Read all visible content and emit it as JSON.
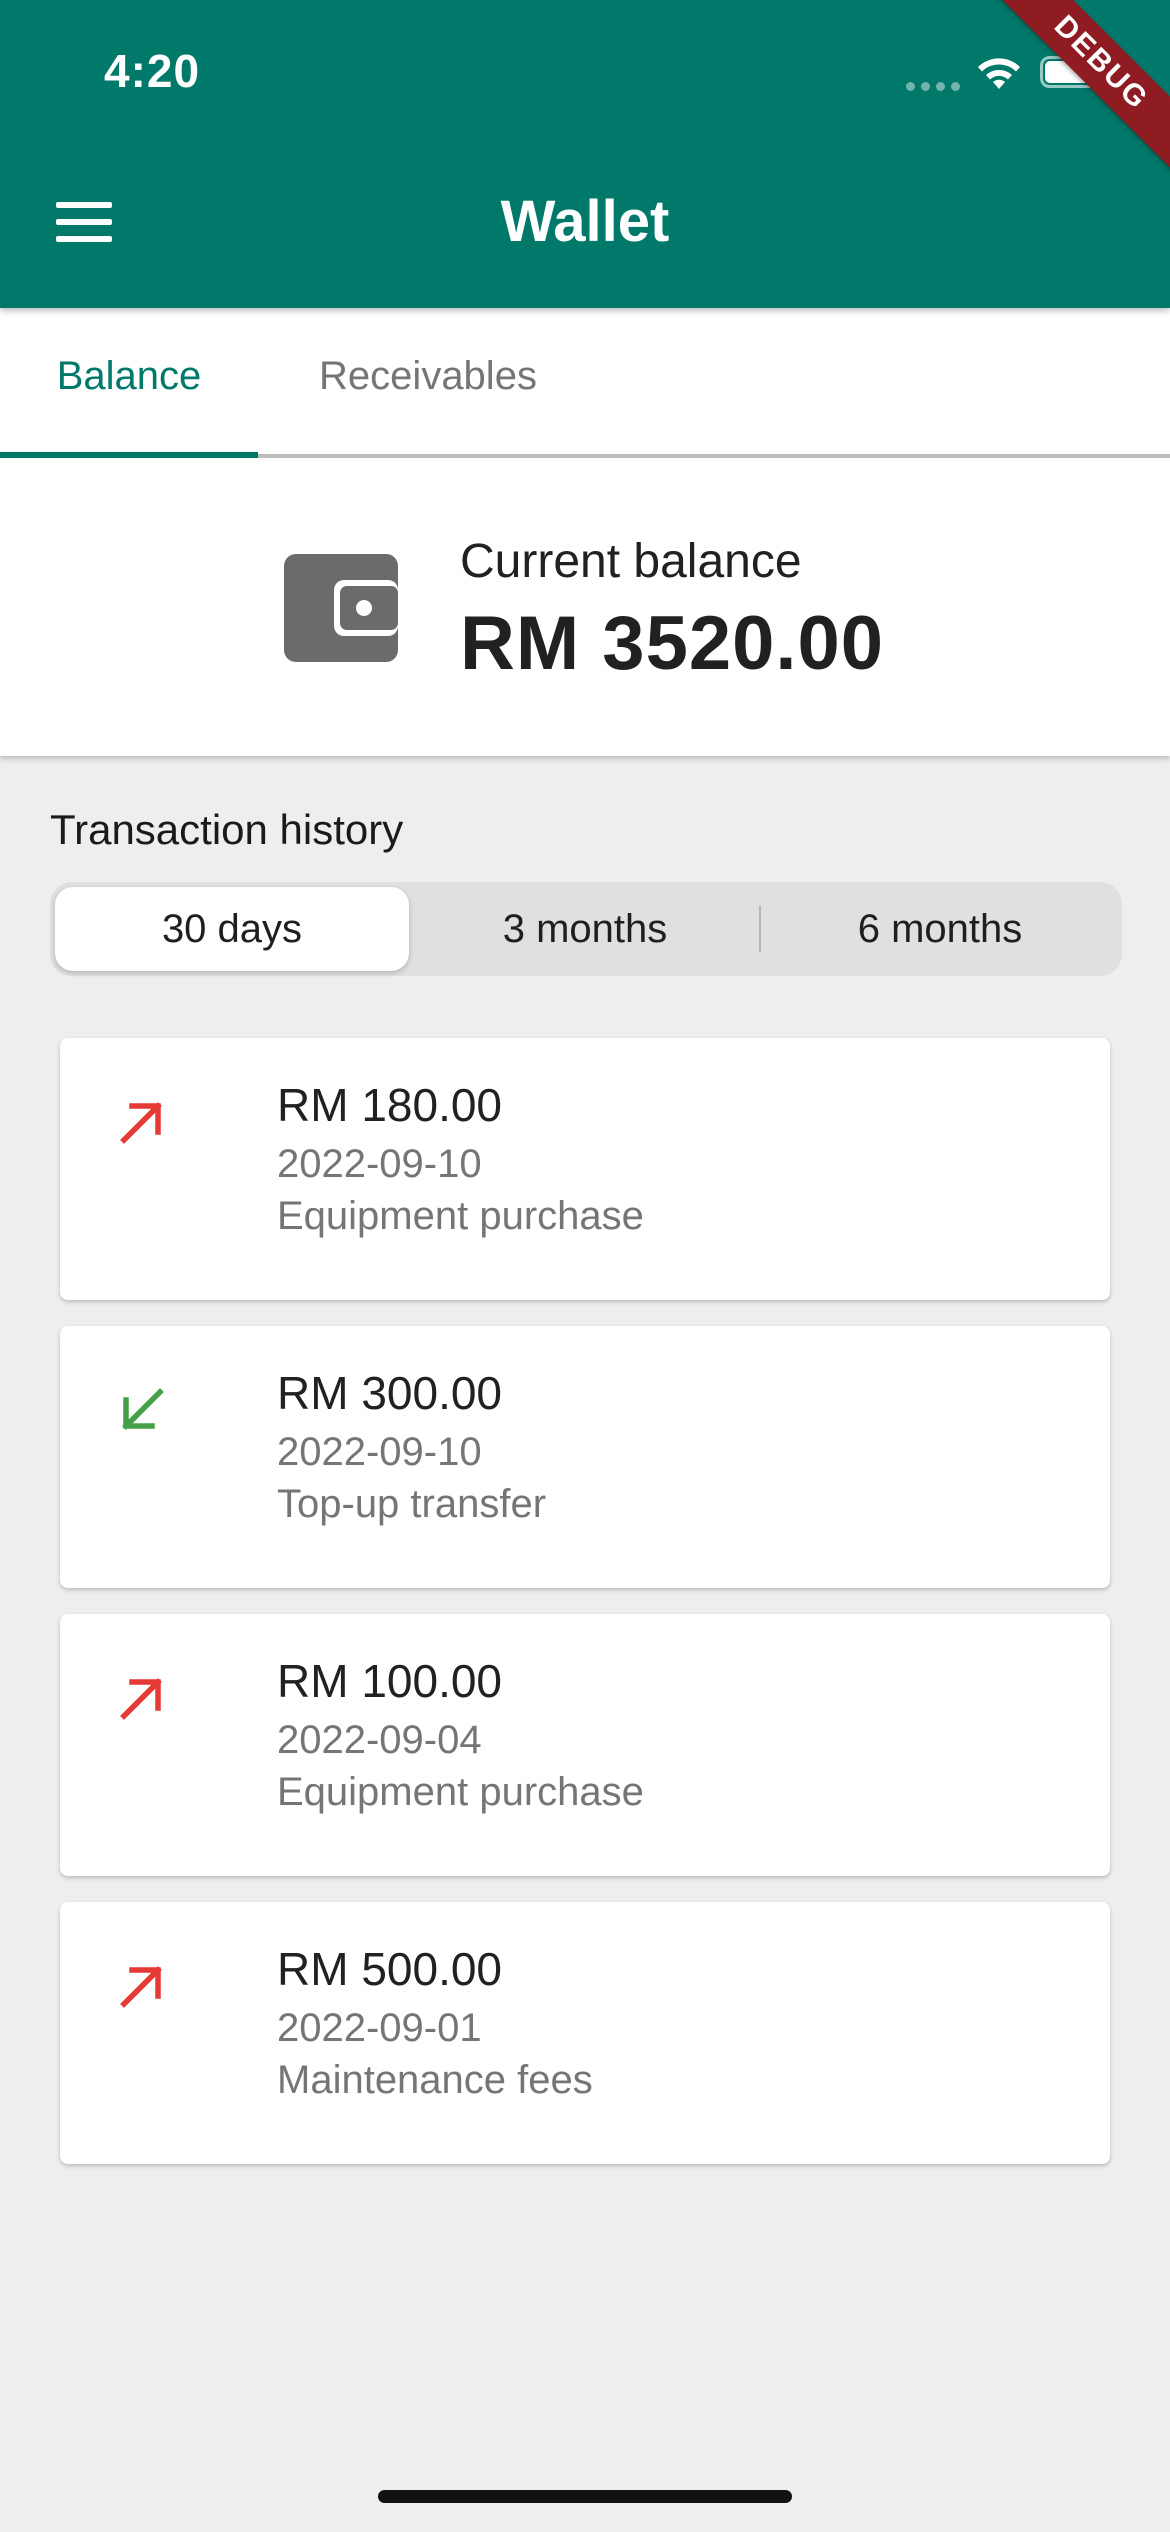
{
  "status_bar": {
    "time": "4:20"
  },
  "debug_banner": "DEBUG",
  "app_bar": {
    "title": "Wallet",
    "menu_icon": "hamburger-menu-icon"
  },
  "tabs": [
    {
      "label": "Balance",
      "active": true
    },
    {
      "label": "Receivables",
      "active": false
    }
  ],
  "balance": {
    "label": "Current balance",
    "value": "RM 3520.00",
    "icon": "wallet-icon"
  },
  "history": {
    "title": "Transaction history",
    "ranges": [
      {
        "label": "30 days",
        "selected": true
      },
      {
        "label": "3 months",
        "selected": false
      },
      {
        "label": "6 months",
        "selected": false
      }
    ],
    "transactions": [
      {
        "direction": "outgoing",
        "amount": "RM 180.00",
        "date": "2022-09-10",
        "description": "Equipment purchase"
      },
      {
        "direction": "incoming",
        "amount": "RM 300.00",
        "date": "2022-09-10",
        "description": "Top-up transfer"
      },
      {
        "direction": "outgoing",
        "amount": "RM 100.00",
        "date": "2022-09-04",
        "description": "Equipment purchase"
      },
      {
        "direction": "outgoing",
        "amount": "RM 500.00",
        "date": "2022-09-01",
        "description": "Maintenance fees"
      }
    ]
  },
  "colors": {
    "primary": "#00796b",
    "outgoing": "#e53935",
    "incoming": "#43a047",
    "background": "#eeeeee",
    "debug_ribbon": "#8e1c22"
  }
}
